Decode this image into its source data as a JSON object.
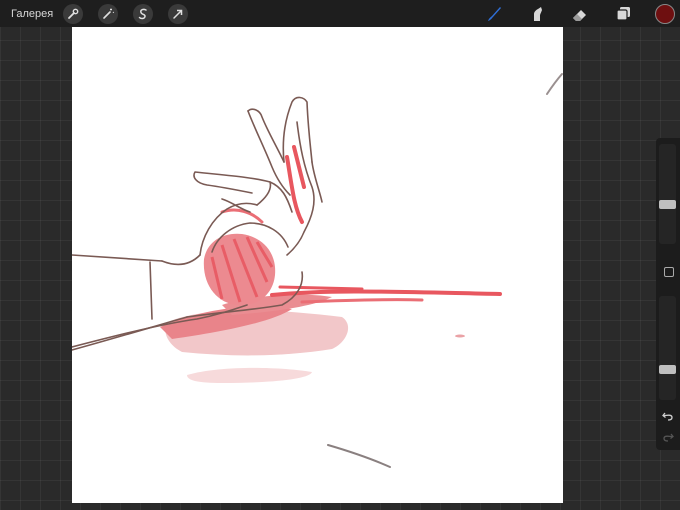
{
  "app": {
    "gallery_label": "Галерея",
    "active_color": "#6e0f10",
    "accent_color": "#2f6fd8"
  },
  "toolbar": {
    "left_tools": [
      "wrench-icon",
      "magic-wand-icon",
      "selection-icon",
      "transform-arrow-icon"
    ],
    "right_tools": [
      "brush-icon",
      "smudge-icon",
      "eraser-icon",
      "layers-icon"
    ],
    "active_tool": "brush-icon"
  },
  "sidebar": {
    "brush_size_level": 0.62,
    "opacity_level": 0.73,
    "buttons": [
      "modify-button",
      "undo-icon",
      "redo-icon"
    ]
  }
}
